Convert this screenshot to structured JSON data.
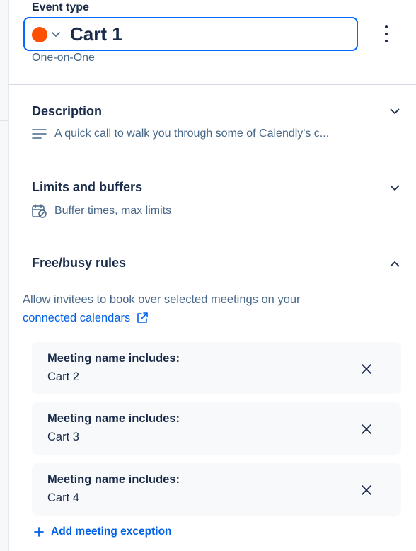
{
  "event": {
    "type_label": "Event type",
    "name": "Cart 1",
    "kind": "One-on-One",
    "color": "#ff4f00"
  },
  "sections": {
    "description": {
      "title": "Description",
      "summary": "A quick call to walk you through some of Calendly's c...",
      "icon": "text-lines-icon",
      "state": "collapsed"
    },
    "limits": {
      "title": "Limits and buffers",
      "summary": "Buffer times, max limits",
      "icon": "calendar-block-icon",
      "state": "collapsed"
    },
    "freebusy": {
      "title": "Free/busy rules",
      "state": "expanded",
      "description": "Allow invitees to book over selected meetings on your",
      "link_label": "connected calendars",
      "link_icon": "external-link-icon",
      "rules": [
        {
          "label": "Meeting name includes:",
          "value": "Cart 2"
        },
        {
          "label": "Meeting name includes:",
          "value": "Cart 3"
        },
        {
          "label": "Meeting name includes:",
          "value": "Cart 4"
        }
      ],
      "add_label": "Add meeting exception"
    }
  },
  "colors": {
    "accent": "#0069ff",
    "link": "#0060e6",
    "text": "#1a2b49",
    "muted": "#476788",
    "card_bg": "#f8f9fb"
  }
}
